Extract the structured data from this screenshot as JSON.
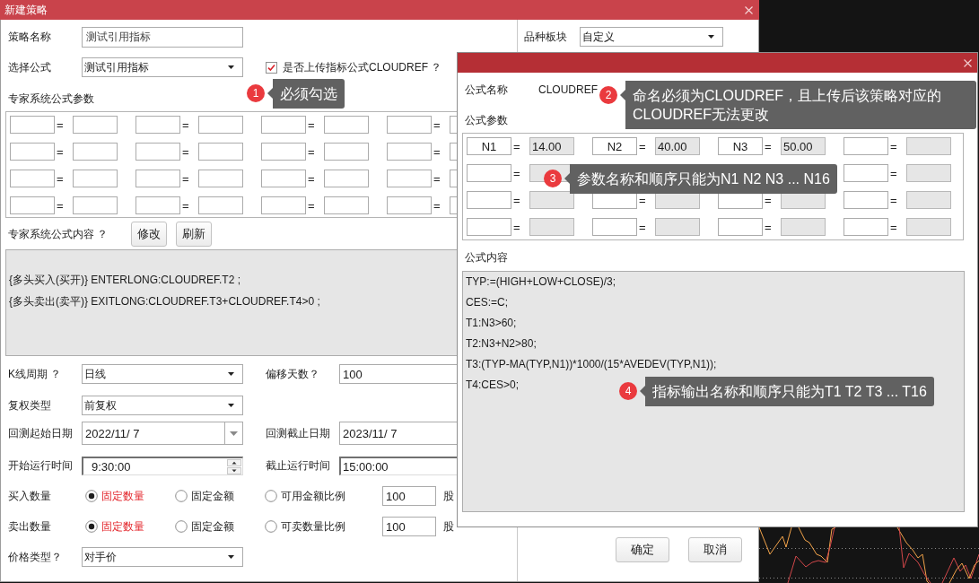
{
  "strategy_dialog": {
    "title": "新建策略",
    "name_field": {
      "label": "策略名称",
      "value": "测试引用指标"
    },
    "formula_field": {
      "label": "选择公式",
      "value": "测试引用指标"
    },
    "upload_checkbox": {
      "label": "是否上传指标公式CLOUDREF ？",
      "checked": true
    },
    "params_heading": "专家系统公式参数",
    "params": [
      {
        "sign": "="
      },
      {
        "sign": "="
      },
      {
        "sign": "="
      },
      {
        "sign": "="
      },
      {
        "sign": "="
      },
      {
        "sign": "="
      },
      {
        "sign": "="
      },
      {
        "sign": "="
      },
      {
        "sign": "="
      },
      {
        "sign": "="
      },
      {
        "sign": "="
      },
      {
        "sign": "="
      },
      {
        "sign": "="
      },
      {
        "sign": "="
      },
      {
        "sign": "="
      },
      {
        "sign": "="
      }
    ],
    "content_heading": "专家系统公式内容 ？",
    "content_buttons": [
      {
        "label": "修改"
      },
      {
        "label": "刷新"
      }
    ],
    "content_lines": [
      "{多头买入(买开)} ENTERLONG:CLOUDREF.T2 ;",
      "{多头卖出(卖平)} EXITLONG:CLOUDREF.T3+CLOUDREF.T4>0 ;"
    ],
    "settings": [
      {
        "fields": [
          {
            "kind": "select",
            "label": "K线周期 ？",
            "value": "日线"
          },
          {
            "kind": "text",
            "label": "偏移天数？",
            "value": "100"
          }
        ]
      },
      {
        "fields": [
          {
            "kind": "select",
            "label": "复权类型",
            "value": "前复权"
          }
        ]
      },
      {
        "fields": [
          {
            "kind": "date",
            "label": "回测起始日期",
            "value": "2022/11/ 7"
          },
          {
            "kind": "text",
            "label": "回测截止日期",
            "value": "2023/11/ 7"
          }
        ]
      },
      {
        "fields": [
          {
            "kind": "spin",
            "label": "开始运行时间",
            "value": "9:30:00"
          },
          {
            "kind": "inset",
            "label": "截止运行时间",
            "value": "15:00:00"
          }
        ]
      },
      {
        "fields": [
          {
            "kind": "radio",
            "label": "买入数量",
            "options": [
              {
                "label": "固定数量",
                "selected": true
              },
              {
                "label": "固定金额",
                "selected": false
              },
              {
                "label": "可用金额比例",
                "selected": false
              }
            ],
            "amount": "100",
            "unit": "股"
          }
        ]
      },
      {
        "fields": [
          {
            "kind": "radio",
            "label": "卖出数量",
            "options": [
              {
                "label": "固定数量",
                "selected": true
              },
              {
                "label": "固定金额",
                "selected": false
              },
              {
                "label": "可卖数量比例",
                "selected": false
              }
            ],
            "amount": "100",
            "unit": "股"
          }
        ]
      },
      {
        "fields": [
          {
            "kind": "select",
            "label": "价格类型？",
            "value": "对手价"
          }
        ]
      }
    ],
    "symbol_field": {
      "label": "品种板块",
      "value": "自定义"
    },
    "buttons": [
      {
        "label": "确定"
      },
      {
        "label": "取消"
      }
    ]
  },
  "formula_dialog": {
    "name_label": "公式名称",
    "name_value": "CLOUDREF",
    "params_heading": "公式参数",
    "params": [
      {
        "name": "N1",
        "sign": "=",
        "value": "14.00"
      },
      {
        "name": "N2",
        "sign": "=",
        "value": "40.00"
      },
      {
        "name": "N3",
        "sign": "=",
        "value": "50.00"
      },
      {
        "sign": "="
      },
      {
        "sign": "="
      },
      {
        "sign": "="
      },
      {
        "sign": "="
      },
      {
        "sign": "="
      },
      {
        "sign": "="
      },
      {
        "sign": "="
      },
      {
        "sign": "="
      },
      {
        "sign": "="
      },
      {
        "sign": "="
      },
      {
        "sign": "="
      }
    ],
    "content_heading": "公式内容",
    "content_lines": [
      "TYP:=(HIGH+LOW+CLOSE)/3;",
      "CES:=C;",
      "T1:N3>60;",
      "T2:N3+N2>80;",
      "T3:(TYP-MA(TYP,N1))*1000/(15*AVEDEV(TYP,N1));",
      "T4:CES>0;"
    ]
  },
  "callouts": [
    {
      "number": "1",
      "text": "必须勾选"
    },
    {
      "number": "2",
      "text": "命名必须为CLOUDREF，且上传后该策略对应的CLOUDREF无法更改"
    },
    {
      "number": "3",
      "text": "参数名称和顺序只能为N1 N2 N3 ... N16"
    },
    {
      "number": "4",
      "text": "指标输出名称和顺序只能为T1 T2 T3 ... T16"
    }
  ]
}
